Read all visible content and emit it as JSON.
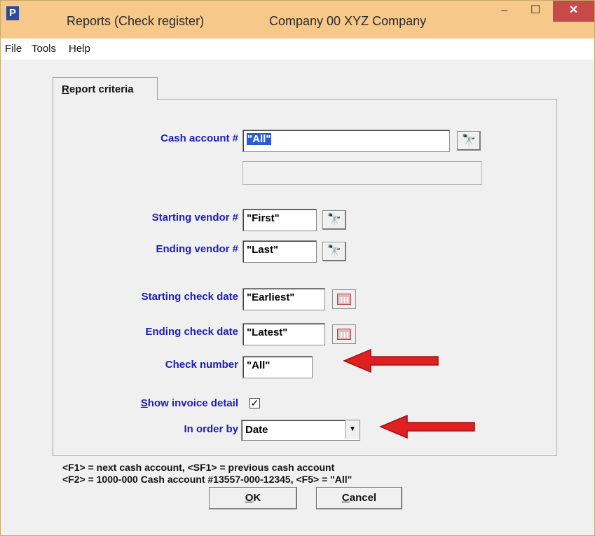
{
  "window": {
    "title": "Reports (Check register)",
    "company": "Company 00  XYZ Company",
    "app_icon": "P",
    "minimize_glyph": "–",
    "maximize_glyph": "☐",
    "close_glyph": "✕"
  },
  "menu": [
    "File",
    "Tools",
    "Help"
  ],
  "tabs": [
    {
      "label": "Report criteria",
      "active": true
    }
  ],
  "form": {
    "cash_account": {
      "label": "Cash account #",
      "value": "\"All\"",
      "description": ""
    },
    "starting_vendor": {
      "label": "Starting vendor #",
      "value": "\"First\""
    },
    "ending_vendor": {
      "label": "Ending vendor #",
      "value": "\"Last\""
    },
    "starting_check_date": {
      "label": "Starting check date",
      "value": "\"Earliest\""
    },
    "ending_check_date": {
      "label": "Ending check date",
      "value": "\"Latest\""
    },
    "check_number": {
      "label": "Check number",
      "value": "\"All\""
    },
    "show_invoice_detail": {
      "label_first": "S",
      "label_rest": "how invoice detail",
      "checked": true,
      "check_glyph": "✓"
    },
    "order_by": {
      "label": "In order by",
      "value": "Date",
      "arrow_glyph": "▼"
    }
  },
  "hints": [
    "<F1> = next cash account, <SF1> = previous cash account",
    "<F2> = 1000-000  Cash account #13557-000-12345, <F5> = \"All\""
  ],
  "buttons": {
    "ok": {
      "first": "O",
      "rest": "K"
    },
    "cancel": {
      "first": "C",
      "rest": "ancel"
    }
  },
  "icons": {
    "lookup": "binoculars-icon",
    "calendar": "calendar-icon"
  },
  "colors": {
    "titlebar": "#f6c88a",
    "label": "#1c1cc0",
    "arrow": "#e02020"
  }
}
